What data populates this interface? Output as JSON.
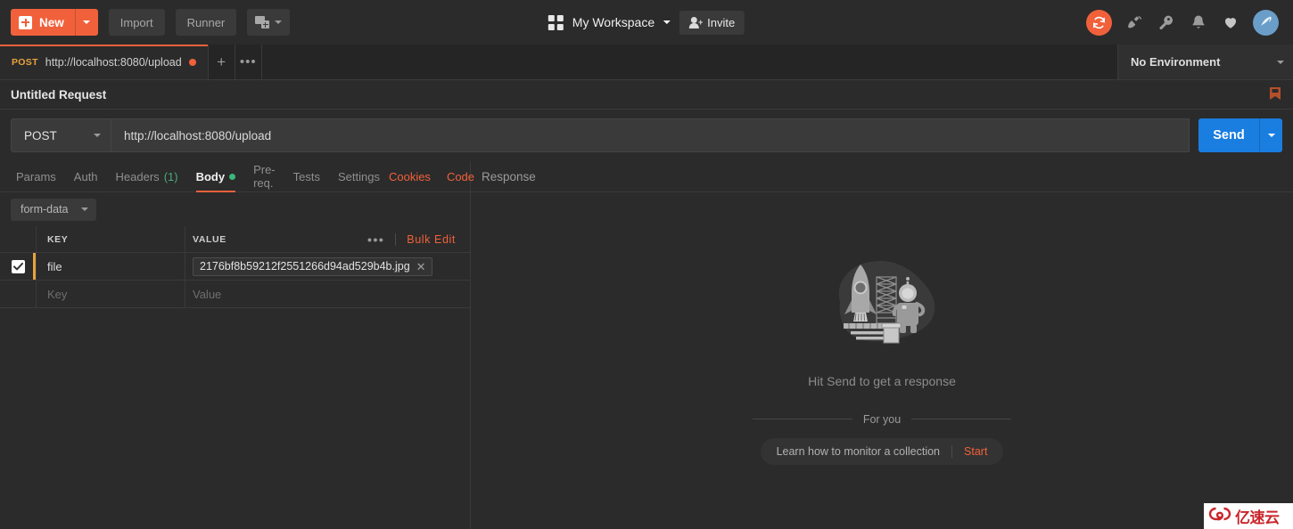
{
  "topbar": {
    "new_label": "New",
    "import_label": "Import",
    "runner_label": "Runner",
    "new_window_icon": "new-window-plus-icon",
    "workspace_name": "My Workspace",
    "invite_label": "Invite",
    "icons": [
      "sync-icon",
      "satellite-icon",
      "wrench-icon",
      "bell-icon",
      "heart-icon",
      "avatar-icon"
    ]
  },
  "tabstrip": {
    "tabs": [
      {
        "method": "POST",
        "name": "http://localhost:8080/upload",
        "unsaved": true
      }
    ],
    "add_label": "+",
    "more_label": "•••",
    "environment": "No Environment"
  },
  "request": {
    "title": "Untitled Request",
    "method": "POST",
    "url": "http://localhost:8080/upload",
    "send_label": "Send"
  },
  "subtabs": {
    "items": [
      {
        "label": "Params",
        "active": false
      },
      {
        "label": "Auth",
        "active": false
      },
      {
        "label": "Headers",
        "count": "(1)",
        "active": false
      },
      {
        "label": "Body",
        "active": true,
        "dot": true
      },
      {
        "label": "Pre-req.",
        "active": false
      },
      {
        "label": "Tests",
        "active": false
      },
      {
        "label": "Settings",
        "active": false
      }
    ],
    "links": [
      "Cookies",
      "Code"
    ]
  },
  "body": {
    "type_label": "form-data",
    "table": {
      "headers": {
        "key": "KEY",
        "value": "VALUE"
      },
      "bulk_edit_label": "Bulk Edit",
      "more_label": "•••",
      "rows": [
        {
          "checked": true,
          "key": "file",
          "value": "2176bf8b59212f2551266d94ad529b4b.jpg",
          "is_file": true
        },
        {
          "checked": false,
          "key_placeholder": "Key",
          "value_placeholder": "Value",
          "is_file": false
        }
      ]
    }
  },
  "response": {
    "title": "Response",
    "empty_hint": "Hit Send to get a response",
    "illustration": "rocket-launchpad-astronaut-illustration",
    "for_you_label": "For you",
    "promo_text": "Learn how to monitor a collection",
    "promo_action": "Start"
  },
  "watermark": {
    "text": "亿速云",
    "logo": "cloud-logo-icon"
  },
  "colors": {
    "accent_orange": "#f0613b",
    "send_blue": "#1a7ee0",
    "method_yellow": "#e8a33d",
    "green_dot": "#39b87a",
    "bg": "#2b2b2b"
  }
}
